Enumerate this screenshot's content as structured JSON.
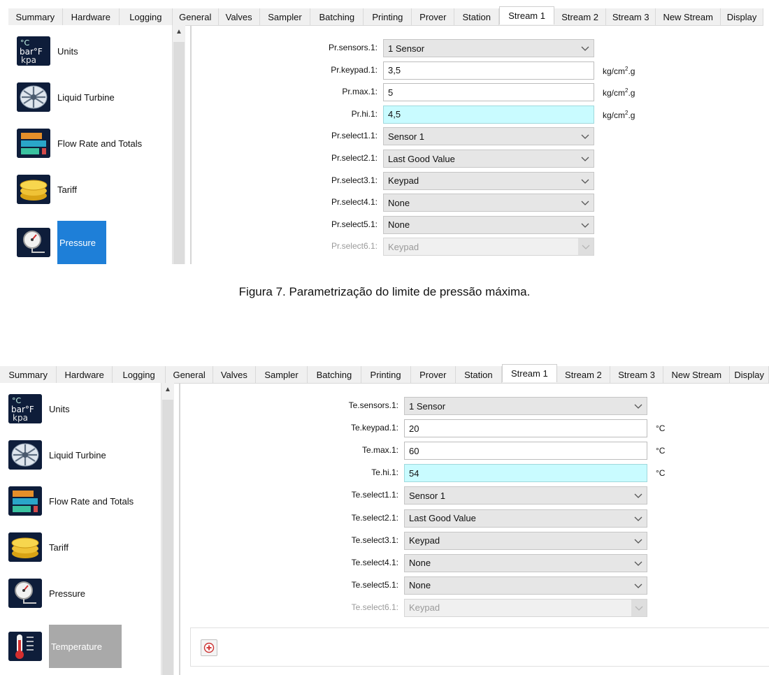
{
  "tabs": [
    "Summary",
    "Hardware",
    "Logging",
    "General",
    "Valves",
    "Sampler",
    "Batching",
    "Printing",
    "Prover",
    "Station",
    "Stream 1",
    "Stream 2",
    "Stream 3",
    "New Stream",
    "Display"
  ],
  "active_tab": "Stream 1",
  "sidebar": [
    {
      "label": "Units",
      "icon": "units-icon"
    },
    {
      "label": "Liquid Turbine",
      "icon": "liquid-turbine-icon"
    },
    {
      "label": "Flow Rate and Totals",
      "icon": "flow-rate-icon"
    },
    {
      "label": "Tariff",
      "icon": "tariff-coins-icon"
    },
    {
      "label": "Pressure",
      "icon": "pressure-gauge-icon"
    },
    {
      "label": "Temperature",
      "icon": "thermometer-icon"
    }
  ],
  "units_icon_text": {
    "top": "°C",
    "mid": "bar°F",
    "bottom": "kpa"
  },
  "pressure_form": {
    "rows": [
      {
        "label": "Pr.sensors.1:",
        "value": "1 Sensor",
        "kind": "select"
      },
      {
        "label": "Pr.keypad.1:",
        "value": "3,5",
        "kind": "input",
        "unit": "kg/cm",
        "unit_sup": "2",
        "unit_tail": ".g"
      },
      {
        "label": "Pr.max.1:",
        "value": "5",
        "kind": "input",
        "unit": "kg/cm",
        "unit_sup": "2",
        "unit_tail": ".g"
      },
      {
        "label": "Pr.hi.1:",
        "value": "4,5",
        "kind": "highlight",
        "unit": "kg/cm",
        "unit_sup": "2",
        "unit_tail": ".g"
      },
      {
        "label": "Pr.select1.1:",
        "value": "Sensor 1",
        "kind": "select"
      },
      {
        "label": "Pr.select2.1:",
        "value": "Last Good Value",
        "kind": "select"
      },
      {
        "label": "Pr.select3.1:",
        "value": "Keypad",
        "kind": "select"
      },
      {
        "label": "Pr.select4.1:",
        "value": "None",
        "kind": "select"
      },
      {
        "label": "Pr.select5.1:",
        "value": "None",
        "kind": "select"
      },
      {
        "label": "Pr.select6.1:",
        "value": "Keypad",
        "kind": "disabled"
      }
    ]
  },
  "caption": "Figura 7. Parametrização do limite de pressão máxima.",
  "temperature_form": {
    "rows": [
      {
        "label": "Te.sensors.1:",
        "value": "1 Sensor",
        "kind": "select"
      },
      {
        "label": "Te.keypad.1:",
        "value": "20",
        "kind": "input",
        "unit": "°C"
      },
      {
        "label": "Te.max.1:",
        "value": "60",
        "kind": "input",
        "unit": "°C"
      },
      {
        "label": "Te.hi.1:",
        "value": "54",
        "kind": "highlight",
        "unit": "°C"
      },
      {
        "label": "Te.select1.1:",
        "value": "Sensor 1",
        "kind": "select"
      },
      {
        "label": "Te.select2.1:",
        "value": "Last Good Value",
        "kind": "select"
      },
      {
        "label": "Te.select3.1:",
        "value": "Keypad",
        "kind": "select"
      },
      {
        "label": "Te.select4.1:",
        "value": "None",
        "kind": "select"
      },
      {
        "label": "Te.select5.1:",
        "value": "None",
        "kind": "select"
      },
      {
        "label": "Te.select6.1:",
        "value": "Keypad",
        "kind": "disabled"
      }
    ]
  },
  "colors": {
    "selected_blue": "#1e7fd8",
    "selected_gray": "#a9a9a9",
    "highlight_cyan": "#c9fbff"
  }
}
